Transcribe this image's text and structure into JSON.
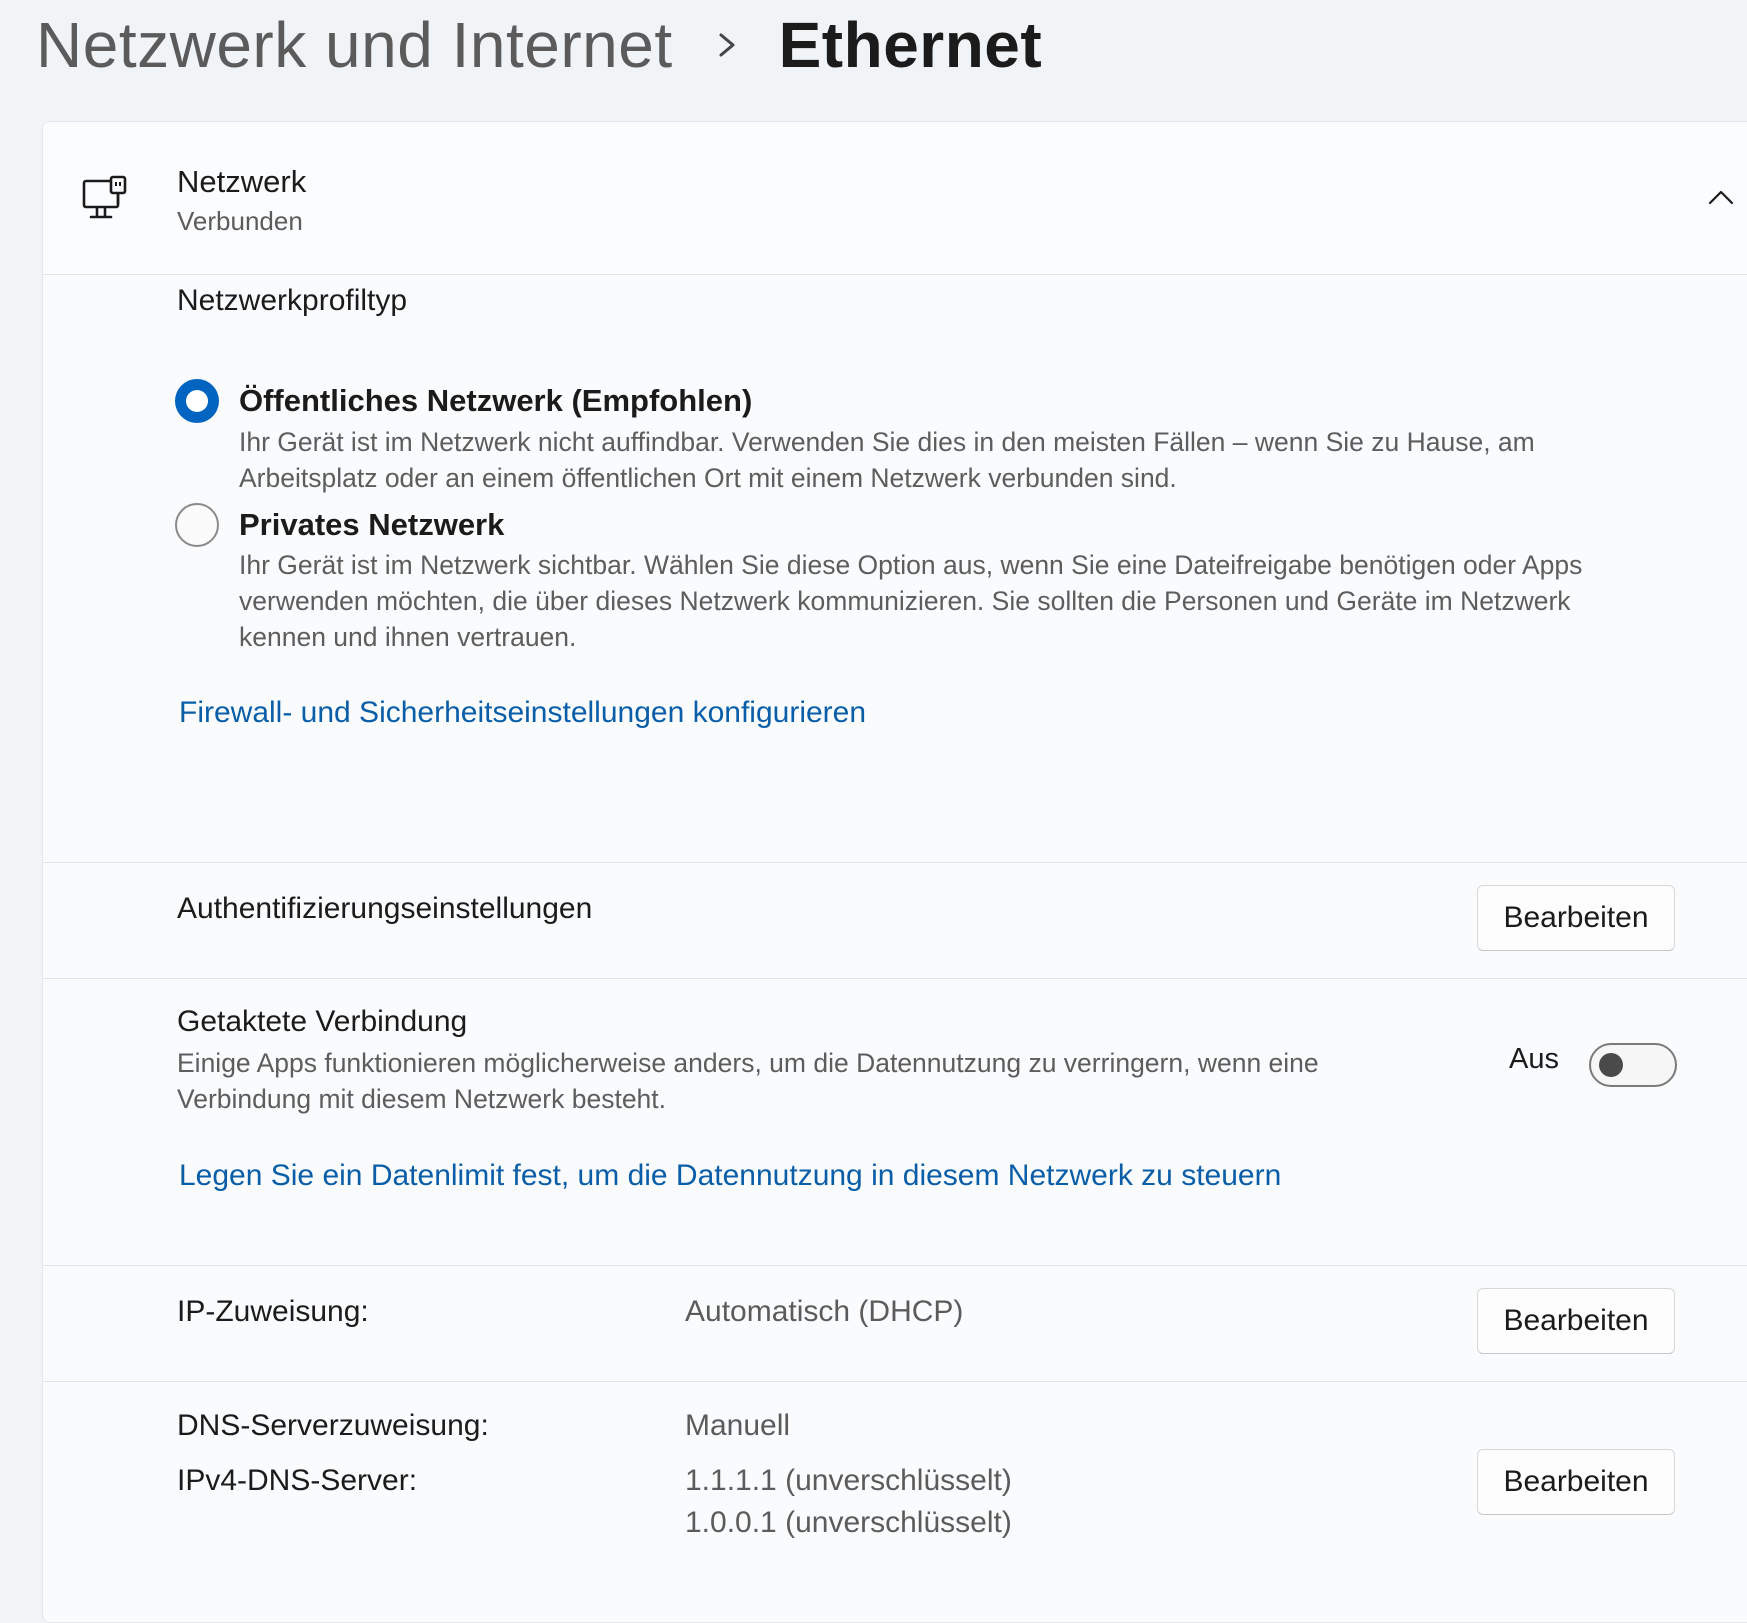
{
  "breadcrumb": {
    "parent": "Netzwerk und Internet",
    "current": "Ethernet"
  },
  "network": {
    "title": "Netzwerk",
    "status": "Verbunden",
    "icon": "ethernet-monitor-icon"
  },
  "profile": {
    "heading": "Netzwerkprofiltyp",
    "options": [
      {
        "label": "Öffentliches Netzwerk (Empfohlen)",
        "description_line1": "Ihr Gerät ist im Netzwerk nicht auffindbar. Verwenden Sie dies in den meisten Fällen – wenn Sie zu Hause, am",
        "description_line2": "Arbeitsplatz oder an einem öffentlichen Ort mit einem Netzwerk verbunden sind.",
        "selected": true
      },
      {
        "label": "Privates Netzwerk",
        "description_line1": "Ihr Gerät ist im Netzwerk sichtbar. Wählen Sie diese Option aus, wenn Sie eine Dateifreigabe benötigen oder Apps",
        "description_line2": "verwenden möchten, die über dieses Netzwerk kommunizieren. Sie sollten die Personen und Geräte im Netzwerk",
        "description_line3": "kennen und ihnen vertrauen.",
        "selected": false
      }
    ],
    "firewall_link": "Firewall- und Sicherheitseinstellungen konfigurieren"
  },
  "auth": {
    "label": "Authentifizierungseinstellungen",
    "button": "Bearbeiten"
  },
  "metered": {
    "label": "Getaktete Verbindung",
    "description_line1": "Einige Apps funktionieren möglicherweise anders, um die Datennutzung zu verringern, wenn eine",
    "description_line2": "Verbindung mit diesem Netzwerk besteht.",
    "toggle_state": "Aus",
    "toggle_on": false,
    "data_limit_link": "Legen Sie ein Datenlimit fest, um die Datennutzung in diesem Netzwerk zu steuern"
  },
  "ip": {
    "label": "IP-Zuweisung:",
    "value": "Automatisch (DHCP)",
    "button": "Bearbeiten"
  },
  "dns": {
    "label": "DNS-Serverzuweisung:",
    "value": "Manuell",
    "ipv4_label": "IPv4-DNS-Server:",
    "ipv4_server1": "1.1.1.1 (unverschlüsselt)",
    "ipv4_server2": "1.0.0.1 (unverschlüsselt)",
    "button": "Bearbeiten"
  },
  "colors": {
    "accent": "#0064c0",
    "link": "#0a5ea8"
  }
}
